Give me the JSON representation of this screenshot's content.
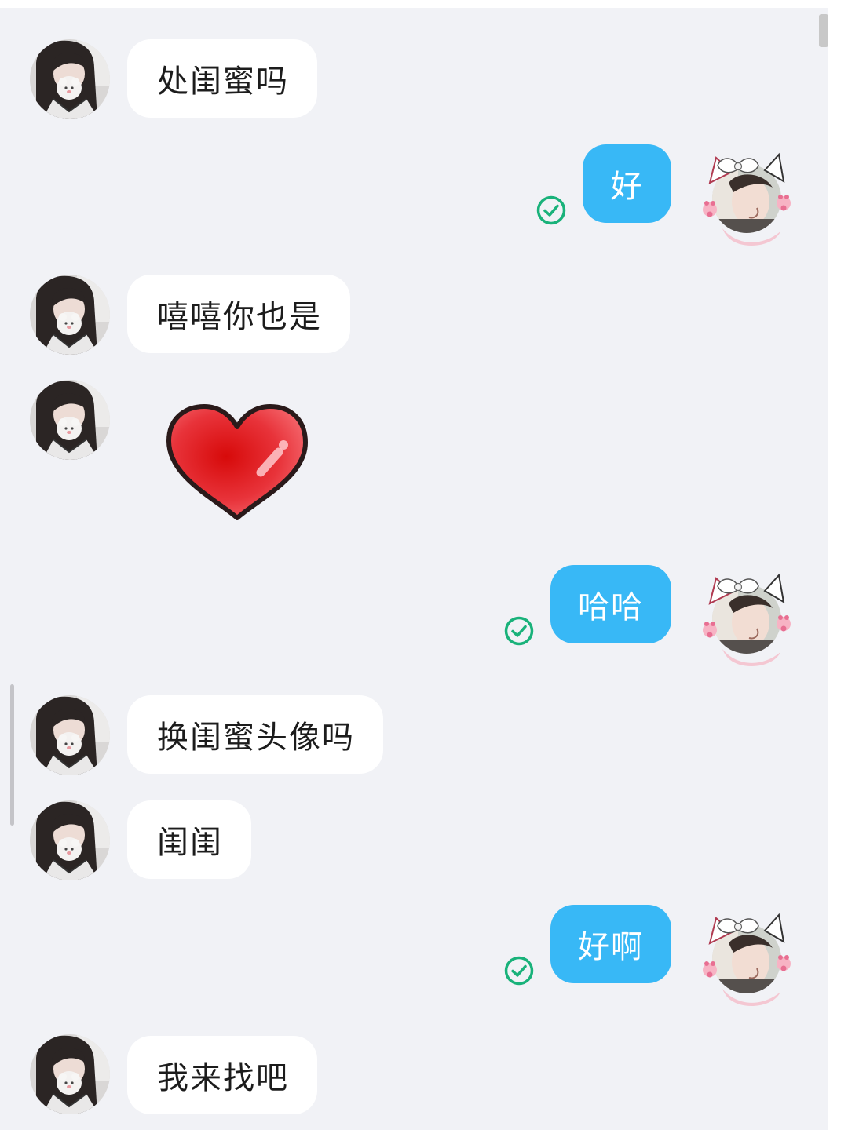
{
  "colors": {
    "background": "#f1f2f6",
    "incoming_bubble": "#ffffff",
    "outgoing_bubble": "#38b8f6",
    "read_tick": "#19b27a"
  },
  "contact": {
    "avatar_icon": "girl-with-plush-avatar"
  },
  "me": {
    "avatar_icon": "cat-ear-girl-avatar"
  },
  "messages": [
    {
      "side": "in",
      "type": "text",
      "text": "处闺蜜吗"
    },
    {
      "side": "out",
      "type": "text",
      "text": "好",
      "status_icon": "read-check-icon"
    },
    {
      "side": "in",
      "type": "text",
      "text": "嘻嘻你也是"
    },
    {
      "side": "in",
      "type": "sticker",
      "sticker_icon": "red-heart-icon"
    },
    {
      "side": "out",
      "type": "text",
      "text": "哈哈",
      "status_icon": "read-check-icon"
    },
    {
      "side": "in",
      "type": "text",
      "text": "换闺蜜头像吗"
    },
    {
      "side": "in",
      "type": "text",
      "text": "闺闺"
    },
    {
      "side": "out",
      "type": "text",
      "text": "好啊",
      "status_icon": "read-check-icon"
    },
    {
      "side": "in",
      "type": "text",
      "text": "我来找吧"
    }
  ]
}
